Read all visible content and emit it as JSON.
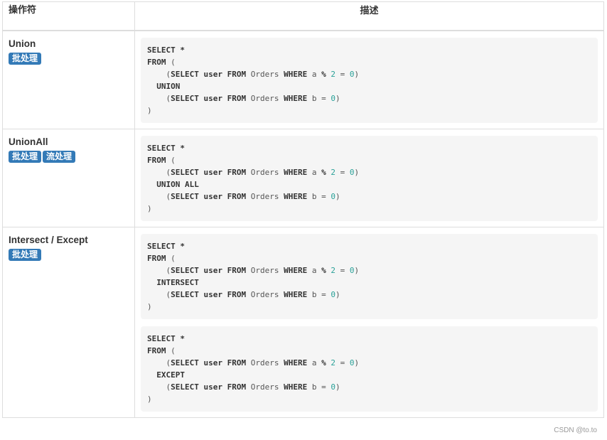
{
  "table": {
    "headers": {
      "operator": "操作符",
      "description": "描述"
    },
    "rows": [
      {
        "name": "Union",
        "badges": [
          "批处理"
        ],
        "code_blocks": [
          [
            [
              [
                "kw",
                "SELECT *"
              ]
            ],
            [
              [
                "kw",
                "FROM"
              ],
              [
                "t",
                " ("
              ]
            ],
            [
              [
                "t",
                "    ("
              ],
              [
                "kw",
                "SELECT user FROM"
              ],
              [
                "t",
                " Orders "
              ],
              [
                "kw",
                "WHERE"
              ],
              [
                "t",
                " a "
              ],
              [
                "kw",
                "%"
              ],
              [
                "t",
                " "
              ],
              [
                "num",
                "2"
              ],
              [
                "t",
                " = "
              ],
              [
                "num",
                "0"
              ],
              [
                "t",
                ")"
              ]
            ],
            [
              [
                "t",
                "  "
              ],
              [
                "kw",
                "UNION"
              ]
            ],
            [
              [
                "t",
                "    ("
              ],
              [
                "kw",
                "SELECT user FROM"
              ],
              [
                "t",
                " Orders "
              ],
              [
                "kw",
                "WHERE"
              ],
              [
                "t",
                " b = "
              ],
              [
                "num",
                "0"
              ],
              [
                "t",
                ")"
              ]
            ],
            [
              [
                "t",
                ")"
              ]
            ]
          ]
        ]
      },
      {
        "name": "UnionAll",
        "badges": [
          "批处理",
          "流处理"
        ],
        "code_blocks": [
          [
            [
              [
                "kw",
                "SELECT *"
              ]
            ],
            [
              [
                "kw",
                "FROM"
              ],
              [
                "t",
                " ("
              ]
            ],
            [
              [
                "t",
                "    ("
              ],
              [
                "kw",
                "SELECT user FROM"
              ],
              [
                "t",
                " Orders "
              ],
              [
                "kw",
                "WHERE"
              ],
              [
                "t",
                " a "
              ],
              [
                "kw",
                "%"
              ],
              [
                "t",
                " "
              ],
              [
                "num",
                "2"
              ],
              [
                "t",
                " = "
              ],
              [
                "num",
                "0"
              ],
              [
                "t",
                ")"
              ]
            ],
            [
              [
                "t",
                "  "
              ],
              [
                "kw",
                "UNION ALL"
              ]
            ],
            [
              [
                "t",
                "    ("
              ],
              [
                "kw",
                "SELECT user FROM"
              ],
              [
                "t",
                " Orders "
              ],
              [
                "kw",
                "WHERE"
              ],
              [
                "t",
                " b = "
              ],
              [
                "num",
                "0"
              ],
              [
                "t",
                ")"
              ]
            ],
            [
              [
                "t",
                ")"
              ]
            ]
          ]
        ]
      },
      {
        "name": "Intersect / Except",
        "badges": [
          "批处理"
        ],
        "code_blocks": [
          [
            [
              [
                "kw",
                "SELECT *"
              ]
            ],
            [
              [
                "kw",
                "FROM"
              ],
              [
                "t",
                " ("
              ]
            ],
            [
              [
                "t",
                "    ("
              ],
              [
                "kw",
                "SELECT user FROM"
              ],
              [
                "t",
                " Orders "
              ],
              [
                "kw",
                "WHERE"
              ],
              [
                "t",
                " a "
              ],
              [
                "kw",
                "%"
              ],
              [
                "t",
                " "
              ],
              [
                "num",
                "2"
              ],
              [
                "t",
                " = "
              ],
              [
                "num",
                "0"
              ],
              [
                "t",
                ")"
              ]
            ],
            [
              [
                "t",
                "  "
              ],
              [
                "kw",
                "INTERSECT"
              ]
            ],
            [
              [
                "t",
                "    ("
              ],
              [
                "kw",
                "SELECT user FROM"
              ],
              [
                "t",
                " Orders "
              ],
              [
                "kw",
                "WHERE"
              ],
              [
                "t",
                " b = "
              ],
              [
                "num",
                "0"
              ],
              [
                "t",
                ")"
              ]
            ],
            [
              [
                "t",
                ")"
              ]
            ]
          ],
          [
            [
              [
                "kw",
                "SELECT *"
              ]
            ],
            [
              [
                "kw",
                "FROM"
              ],
              [
                "t",
                " ("
              ]
            ],
            [
              [
                "t",
                "    ("
              ],
              [
                "kw",
                "SELECT user FROM"
              ],
              [
                "t",
                " Orders "
              ],
              [
                "kw",
                "WHERE"
              ],
              [
                "t",
                " a "
              ],
              [
                "kw",
                "%"
              ],
              [
                "t",
                " "
              ],
              [
                "num",
                "2"
              ],
              [
                "t",
                " = "
              ],
              [
                "num",
                "0"
              ],
              [
                "t",
                ")"
              ]
            ],
            [
              [
                "t",
                "  "
              ],
              [
                "kw",
                "EXCEPT"
              ]
            ],
            [
              [
                "t",
                "    ("
              ],
              [
                "kw",
                "SELECT user FROM"
              ],
              [
                "t",
                " Orders "
              ],
              [
                "kw",
                "WHERE"
              ],
              [
                "t",
                " b = "
              ],
              [
                "num",
                "0"
              ],
              [
                "t",
                ")"
              ]
            ],
            [
              [
                "t",
                ")"
              ]
            ]
          ]
        ]
      }
    ]
  },
  "watermark": "CSDN @to.to",
  "colors": {
    "badge": "#337ab7",
    "number": "#2aa198",
    "code_bg": "#f5f5f5",
    "border": "#dddddd"
  }
}
